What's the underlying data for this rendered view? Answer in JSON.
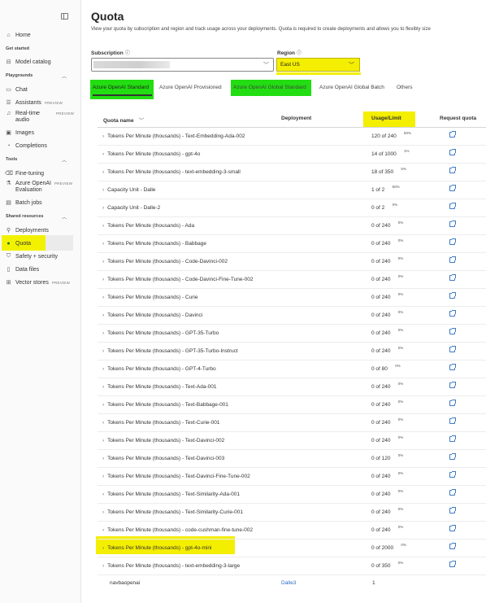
{
  "sidebar": {
    "home": "Home",
    "sections": {
      "get_started": "Get started",
      "playgrounds": "Playgrounds",
      "tools": "Tools",
      "shared_resources": "Shared resources"
    },
    "model_catalog": "Model catalog",
    "chat": "Chat",
    "assistants": "Assistants",
    "realtime_line1": "Real-time",
    "realtime_line2": "audio",
    "images": "Images",
    "completions": "Completions",
    "fine_tuning": "Fine-tuning",
    "aoe_line1": "Azure OpenAI",
    "aoe_line2": "Evaluation",
    "batch_jobs": "Batch jobs",
    "deployments": "Deployments",
    "quota": "Quota",
    "safety": "Safety + security",
    "data_files": "Data files",
    "vector_stores": "Vector stores",
    "preview_badge": "PREVIEW"
  },
  "page": {
    "title": "Quota",
    "description": "View your quota by subscription and region and track usage across your deployments. Quota is required to create deployments and allows you to flexibly size"
  },
  "filters": {
    "subscription_label": "Subscription",
    "region_label": "Region",
    "region_value": "East US"
  },
  "tabs": [
    "Azure OpenAI Standard",
    "Azure OpenAI Provisioned",
    "Azure OpenAI Global Standard",
    "Azure OpenAI Global Batch",
    "Others"
  ],
  "table": {
    "headers": {
      "quota_name": "Quota name",
      "deployment": "Deployment",
      "usage_limit": "Usage/Limit",
      "request_quota": "Request quota"
    },
    "rows": [
      {
        "name": "Tokens Per Minute (thousands) - Text-Embedding-Ada-002",
        "usage": "120 of 240",
        "pct": "50%"
      },
      {
        "name": "Tokens Per Minute (thousands) - gpt-4o",
        "usage": "14 of 1000",
        "pct": "1%"
      },
      {
        "name": "Tokens Per Minute (thousands) - text-embedding-3-small",
        "usage": "18 of 350",
        "pct": "5%"
      },
      {
        "name": "Capacity Unit - Dalle",
        "usage": "1 of 2",
        "pct": "50%"
      },
      {
        "name": "Capacity Unit - Dalle-2",
        "usage": "0 of 2",
        "pct": "0%"
      },
      {
        "name": "Tokens Per Minute (thousands) - Ada",
        "usage": "0 of 240",
        "pct": "0%"
      },
      {
        "name": "Tokens Per Minute (thousands) - Babbage",
        "usage": "0 of 240",
        "pct": "0%"
      },
      {
        "name": "Tokens Per Minute (thousands) - Code-Davinci-002",
        "usage": "0 of 240",
        "pct": "0%"
      },
      {
        "name": "Tokens Per Minute (thousands) - Code-Davinci-Fine-Tune-002",
        "usage": "0 of 240",
        "pct": "0%"
      },
      {
        "name": "Tokens Per Minute (thousands) - Curie",
        "usage": "0 of 240",
        "pct": "0%"
      },
      {
        "name": "Tokens Per Minute (thousands) - Davinci",
        "usage": "0 of 240",
        "pct": "0%"
      },
      {
        "name": "Tokens Per Minute (thousands) - GPT-35-Turbo",
        "usage": "0 of 240",
        "pct": "0%"
      },
      {
        "name": "Tokens Per Minute (thousands) - GPT-35-Turbo-Instruct",
        "usage": "0 of 240",
        "pct": "0%"
      },
      {
        "name": "Tokens Per Minute (thousands) - GPT-4-Turbo",
        "usage": "0 of 80",
        "pct": "0%"
      },
      {
        "name": "Tokens Per Minute (thousands) - Text-Ada-001",
        "usage": "0 of 240",
        "pct": "0%"
      },
      {
        "name": "Tokens Per Minute (thousands) - Text-Babbage-001",
        "usage": "0 of 240",
        "pct": "0%"
      },
      {
        "name": "Tokens Per Minute (thousands) - Text-Curie-001",
        "usage": "0 of 240",
        "pct": "0%"
      },
      {
        "name": "Tokens Per Minute (thousands) - Text-Davinci-002",
        "usage": "0 of 240",
        "pct": "0%"
      },
      {
        "name": "Tokens Per Minute (thousands) - Text-Davinci-003",
        "usage": "0 of 120",
        "pct": "0%"
      },
      {
        "name": "Tokens Per Minute (thousands) - Text-Davinci-Fine-Tune-002",
        "usage": "0 of 240",
        "pct": "0%"
      },
      {
        "name": "Tokens Per Minute (thousands) - Text-Similarity-Ada-001",
        "usage": "0 of 240",
        "pct": "0%"
      },
      {
        "name": "Tokens Per Minute (thousands) - Text-Similarity-Curie-001",
        "usage": "0 of 240",
        "pct": "0%"
      },
      {
        "name": "Tokens Per Minute (thousands) - code-cushman-fine-tune-002",
        "usage": "0 of 240",
        "pct": "0%"
      },
      {
        "name": "Tokens Per Minute (thousands) - gpt-4o-mini",
        "usage": "0 of 2000",
        "pct": "0%"
      },
      {
        "name": "Tokens Per Minute (thousands) - text-embedding-3-large",
        "usage": "0 of 350",
        "pct": "0%"
      }
    ],
    "deployment_row": {
      "name": "navbaopenai",
      "deployment": "Dalle3",
      "usage": "1"
    }
  },
  "colors": {
    "highlight_yellow": "#f4ee00",
    "highlight_green": "#22dd11",
    "link_blue": "#2b6cc4"
  }
}
